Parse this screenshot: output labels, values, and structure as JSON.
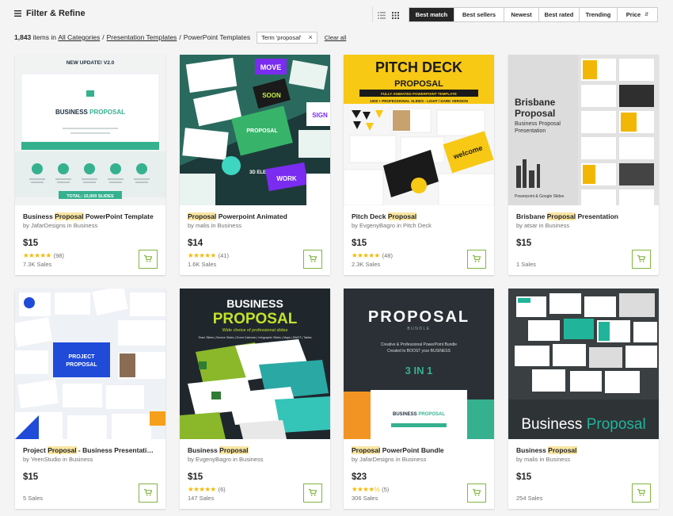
{
  "toolbar": {
    "filter_label": "Filter & Refine",
    "sort_options": [
      "Best match",
      "Best sellers",
      "Newest",
      "Best rated",
      "Trending",
      "Price"
    ],
    "active_sort": "Best match"
  },
  "results": {
    "count": "1,843",
    "items_in": "items in",
    "breadcrumb": [
      "All Categories",
      "Presentation Templates",
      "PowerPoint Templates"
    ],
    "term_chip": "Term 'proposal'",
    "clear_all": "Clear all"
  },
  "colors": {
    "accent_green": "#82b541",
    "star": "#f6b700",
    "highlight": "#f9e6a4",
    "active_sort_bg": "#262626"
  },
  "products": [
    {
      "title_pre": "Business ",
      "title_hl": "Proposal",
      "title_post": " PowerPoint Template",
      "author": "by JafarDesigns in Business",
      "price": "$15",
      "stars": "★★★★★",
      "reviews": "(98)",
      "sales": "7.3K Sales",
      "thumb": {
        "banner": "NEW UPDATE! V2.0",
        "heading_a": "BUSINESS ",
        "heading_b": "PROPOSAL",
        "footer": "TOTAL: 10,000 SLIDES"
      }
    },
    {
      "title_pre": "",
      "title_hl": "Proposal",
      "title_post": " Powerpoint Animated",
      "author": "by malis in Business",
      "price": "$14",
      "stars": "★★★★★",
      "reviews": "(41)",
      "sales": "1.6K Sales",
      "thumb": {
        "t1": "MOVE",
        "t2": "SOON",
        "t3": "PROPOSAL",
        "t4": "WORK",
        "t5": "SIGN",
        "t6": "3D ELEMENT"
      }
    },
    {
      "title_pre": "Pitch Deck ",
      "title_hl": "Proposal",
      "title_post": "",
      "author": "by EvgenyBagro in Pitch Deck",
      "price": "$15",
      "stars": "★★★★★",
      "reviews": "(48)",
      "sales": "2.3K Sales",
      "thumb": {
        "heading": "PITCH DECK",
        "sub": "PROPOSAL",
        "band": "FULLY ANIMATED POWERPOINT TEMPLATE",
        "line": "1000 + PROFESSIONAL SLIDES - LIGHT / DARK VERSION",
        "welcome": "welcome"
      }
    },
    {
      "title_pre": "Brisbane ",
      "title_hl": "Proposal",
      "title_post": " Presentation",
      "author": "by atsar in Business",
      "price": "$15",
      "stars": "",
      "reviews": "",
      "sales": "1 Sales",
      "thumb": {
        "h1": "Brisbane",
        "h2": "Proposal",
        "s1": "Business Proposal",
        "s2": "Presentation",
        "foot": "Powerpoint & Google Slides"
      }
    },
    {
      "title_pre": "Project ",
      "title_hl": "Proposal",
      "title_post": " - Business Presentation Template",
      "author": "by YeenStudio in Business",
      "price": "$15",
      "stars": "",
      "reviews": "",
      "sales": "5 Sales",
      "thumb": {
        "l1": "PROJECT",
        "l2": "PROPOSAL"
      }
    },
    {
      "title_pre": "Business ",
      "title_hl": "Proposal",
      "title_post": "",
      "author": "by EvgenyBagro in Business",
      "price": "$15",
      "stars": "★★★★★",
      "reviews": "(6)",
      "sales": "147 Sales",
      "thumb": {
        "h1": "BUSINESS",
        "h2": "PROPOSAL",
        "tag": "Wide choice of professional slides",
        "small": "Team Slides | Service Slides | Event Calendar | Infographic Slides | Maps | SWOT | Tables"
      }
    },
    {
      "title_pre": "",
      "title_hl": "Proposal",
      "title_post": " PowerPoint Bundle",
      "author": "by JafarDesigns in Business",
      "price": "$23",
      "stars": "★★★★½",
      "reviews": "(5)",
      "sales": "306 Sales",
      "thumb": {
        "h1": "PROPOSAL",
        "b": "BUNDLE",
        "d1": "Creative & Professional PowerPoint Bundle",
        "d2": "Created to BOOST your BUSINESS",
        "big": "3 IN 1",
        "bp1": "BUSINESS ",
        "bp2": "PROPOSAL"
      }
    },
    {
      "title_pre": "Business ",
      "title_hl": "Proposal",
      "title_post": "",
      "author": "by malis in Business",
      "price": "$15",
      "stars": "",
      "reviews": "",
      "sales": "254 Sales",
      "thumb": {
        "a": "Business ",
        "b": "Proposal"
      }
    }
  ]
}
